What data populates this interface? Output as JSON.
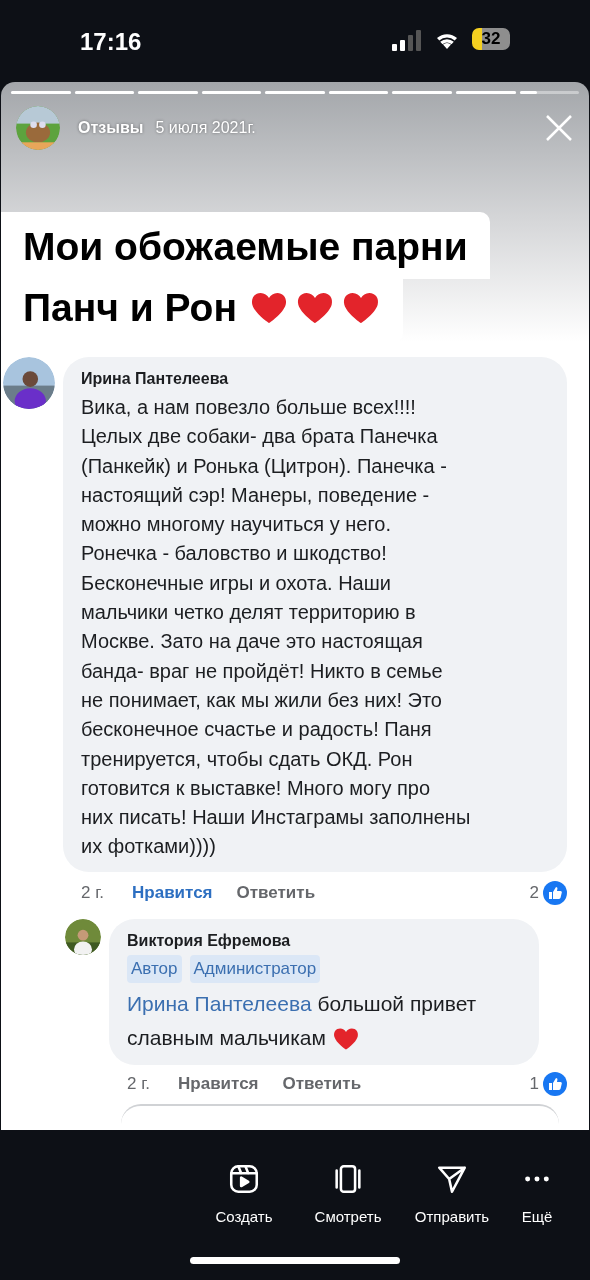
{
  "status_bar": {
    "time": "17:16",
    "battery": "32"
  },
  "story": {
    "progress": [
      {
        "level": 1
      },
      {
        "level": 1
      },
      {
        "level": 1
      },
      {
        "level": 1
      },
      {
        "level": 1
      },
      {
        "level": 1
      },
      {
        "level": 1
      },
      {
        "level": 1
      },
      {
        "level": 0.3
      }
    ],
    "account": "Отзывы",
    "date": "5 июля 2021г.",
    "headline_lines": [
      "Мои обожаемые парни",
      "Панч и Рон"
    ]
  },
  "comment": {
    "author": "Ирина Пантелеева",
    "body_lines": [
      "Вика, а нам повезло больше всех!!!!",
      "Целых две собаки- два брата Панечка",
      "(Панкейк) и Ронька (Цитрон).  Панечка -",
      "настоящий сэр! Манеры, поведение -",
      "можно многому научиться у него.",
      "Ронечка - баловство и шкодство!",
      "Бесконечные игры и охота. Наши",
      "мальчики четко делят территорию в",
      "Москве. Зато на даче это настоящая",
      "банда- враг не пройдёт! Никто в семье",
      "не понимает, как мы жили без них! Это",
      "бесконечное счастье и радость! Паня",
      "тренируется, чтобы сдать ОКД. Рон",
      "готовится к выставке! Много могу про",
      "них писать! Наши Инстаграмы заполнены",
      "их фотками))))"
    ],
    "age": "2 г.",
    "like": "Нравится",
    "liked": true,
    "reply": "Ответить",
    "likes": "2"
  },
  "reply_comment": {
    "author": "Виктория Ефремова",
    "badges": [
      "Автор",
      "Администратор"
    ],
    "mention": "Ирина Пантелеева",
    "body_lines": [
      "большой привет",
      "славным мальчикам"
    ],
    "age": "2 г.",
    "like": "Нравится",
    "liked": false,
    "reply": "Ответить",
    "likes": "1"
  },
  "bottom_actions": [
    {
      "kind": "create",
      "label": "Создать"
    },
    {
      "kind": "watch",
      "label": "Смотреть"
    },
    {
      "kind": "send",
      "label": "Отправить"
    },
    {
      "kind": "more",
      "label": "Ещё"
    }
  ]
}
